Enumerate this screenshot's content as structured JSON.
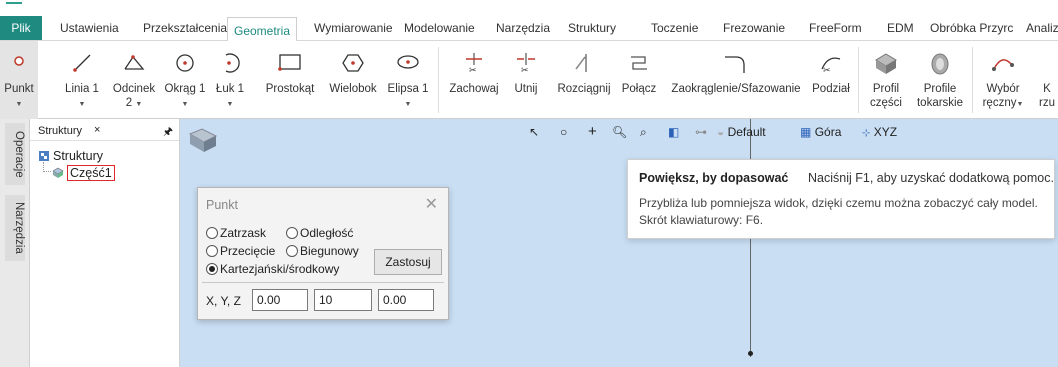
{
  "tabs": {
    "file": "Plik",
    "items": [
      "Ustawienia",
      "Przekształcenia",
      "Geometria",
      "Wymiarowanie",
      "Modelowanie",
      "Narzędzia",
      "Struktury",
      "Toczenie",
      "Frezowanie",
      "FreeForm",
      "EDM",
      "Obróbka Przyrc",
      "Analiz"
    ],
    "active": "Geometria"
  },
  "ribbon": {
    "point": "Punkt",
    "line": "Linia 1",
    "segment": "Odcinek",
    "segment_sub": "2",
    "circle": "Okrąg 1",
    "arc": "Łuk 1",
    "rectangle": "Prostokąt",
    "polygon": "Wielobok",
    "ellipse": "Elipsa 1",
    "keep": "Zachowaj",
    "trim": "Utnij",
    "extend": "Rozciągnij",
    "join": "Połącz",
    "fillet": "Zaokrąglenie/Sfazowanie",
    "split": "Podział",
    "part_profile_1": "Profil",
    "part_profile_2": "części",
    "turn_profile_1": "Profile",
    "turn_profile_2": "tokarskie",
    "manual_1": "Wybór",
    "manual_2": "ręczny",
    "more_1": "K",
    "more_2": "rzu"
  },
  "side": {
    "operations": "Operacje",
    "tools": "Narzędzia"
  },
  "panel": {
    "title": "Struktury",
    "close": "×",
    "pin": "🖈",
    "root": "Struktury",
    "child": "Część1"
  },
  "viewtoolbar": {
    "default": "Default",
    "top": "Góra",
    "xyz": "XYZ"
  },
  "dialog": {
    "title": "Punkt",
    "close": "✕",
    "options": [
      "Zatrzask",
      "Odległość",
      "Przecięcie",
      "Biegunowy",
      "Kartezjański/środkowy"
    ],
    "selected": "Kartezjański/środkowy",
    "apply": "Zastosuj",
    "coords_label": "X, Y, Z",
    "x": "0.00",
    "y": "10",
    "z": "0.00"
  },
  "tooltip": {
    "title": "Powiększ, by dopasować",
    "hint": "Naciśnij F1, aby uzyskać dodatkową pomoc.",
    "line1": "Przybliża lub pomniejsza widok, dzięki czemu można zobaczyć cały model.",
    "line2": "Skrót klawiaturowy: F6."
  },
  "colors": {
    "accent": "#1e8a80",
    "viewport": "#c9def3",
    "highlight": "#e0282c",
    "icon_red": "#c0392b"
  }
}
